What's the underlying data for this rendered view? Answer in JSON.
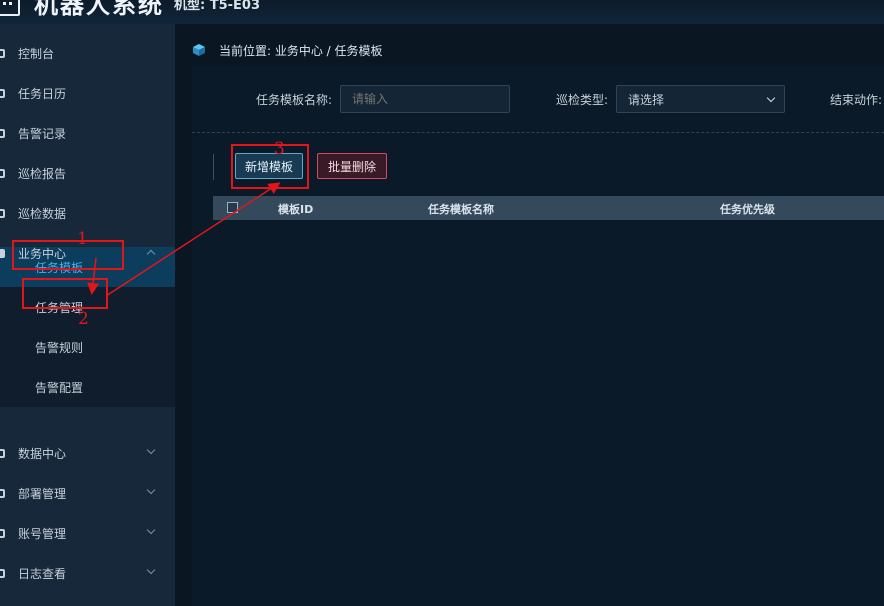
{
  "header": {
    "title": "机器人系统",
    "model_label": "机型: T5-E03"
  },
  "sidebar": {
    "items": [
      {
        "label": "控制台"
      },
      {
        "label": "任务日历"
      },
      {
        "label": "告警记录"
      },
      {
        "label": "巡检报告"
      },
      {
        "label": "巡检数据"
      },
      {
        "label": "业务中心"
      },
      {
        "label": "数据中心"
      },
      {
        "label": "部署管理"
      },
      {
        "label": "账号管理"
      },
      {
        "label": "日志查看"
      }
    ],
    "business_sub": [
      {
        "label": "任务模板",
        "active": true
      },
      {
        "label": "任务管理"
      },
      {
        "label": "告警规则"
      },
      {
        "label": "告警配置"
      }
    ]
  },
  "breadcrumb": {
    "text": "当前位置: 业务中心 / 任务模板"
  },
  "filters": {
    "name_label": "任务模板名称:",
    "name_placeholder": "请输入",
    "type_label": "巡检类型:",
    "type_value": "请选择",
    "end_label": "结束动作:"
  },
  "toolbar": {
    "add_label": "新增模板",
    "delete_label": "批量删除"
  },
  "table": {
    "columns": [
      "模板ID",
      "任务模板名称",
      "任务优先级"
    ]
  },
  "annotations": {
    "one": "1",
    "two": "2",
    "three": "3"
  },
  "colors": {
    "active_text": "#3fb6ee",
    "annotation": "#e0161b",
    "delete_border": "#d04b61"
  }
}
